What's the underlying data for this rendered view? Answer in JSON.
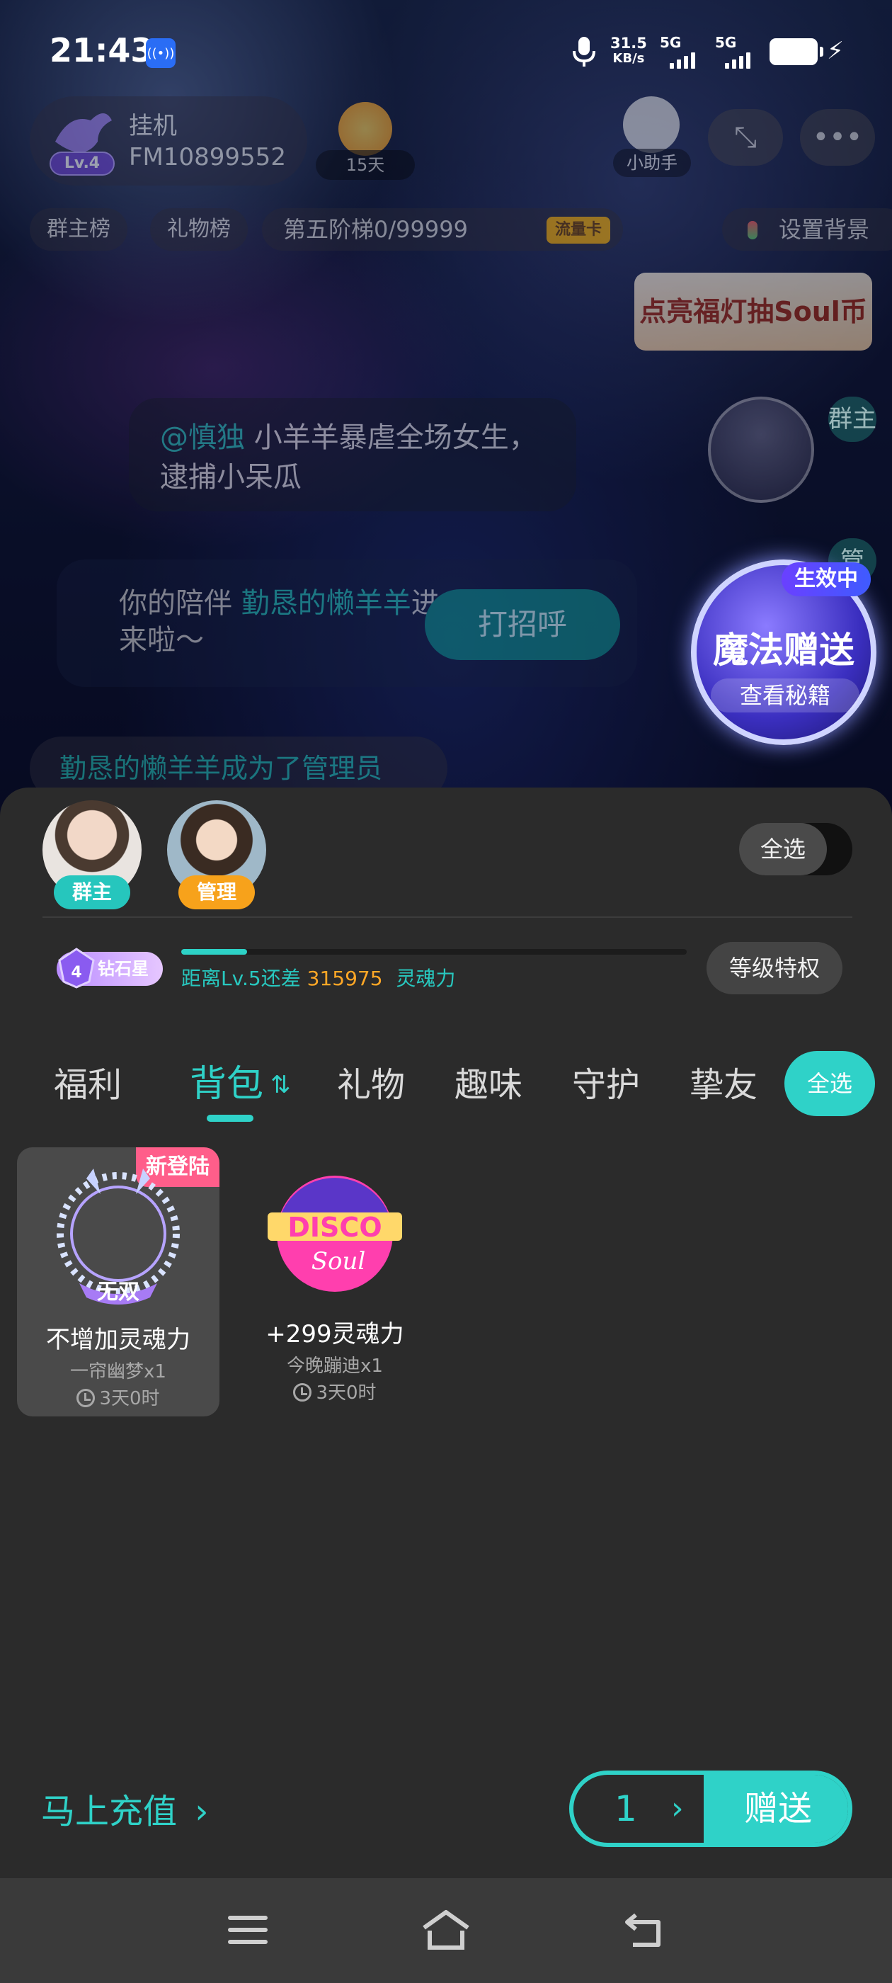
{
  "status_bar": {
    "time": "21:43",
    "net_speed_value": "31.5",
    "net_speed_unit": "KB/s",
    "sim1_label": "5G",
    "sim2_label": "5G"
  },
  "room": {
    "name": "挂机",
    "id": "FM10899552",
    "level": "Lv.4",
    "days": "15天",
    "assistant_label": "小助手",
    "chips": [
      "群主榜",
      "礼物榜"
    ],
    "ladder": "第五阶梯0/99999",
    "ladder_card": "流量卡",
    "set_background": "设置背景",
    "lucky_banner": "点亮福灯抽Soul币",
    "chat_mention": "@慎独",
    "chat_text": " 小羊羊暴虐全场女生，逮捕小呆瓜",
    "welcome_prefix": "你的陪伴 ",
    "welcome_name": "勤恳的懒羊羊",
    "welcome_suffix": "进来啦～",
    "hello_button": "打招呼",
    "admin_message": "勤恳的懒羊羊成为了管理员",
    "side_tab_1": "群主",
    "side_tab_2": "管"
  },
  "magic": {
    "active": "生效中",
    "title": "魔法赠送",
    "sub": "查看秘籍"
  },
  "panel": {
    "recipients": [
      {
        "role": "群主"
      },
      {
        "role": "管理"
      }
    ],
    "select_all_toggle": "全选",
    "level_badge": "钻石星",
    "level_badge_num": "4",
    "level_progress_fraction": 0.13,
    "level_text_prefix": "距离Lv.5还差",
    "level_text_num": "315975",
    "level_text_suffix": "灵魂力",
    "privilege_button": "等级特权",
    "tabs": [
      "福利",
      "背包",
      "礼物",
      "趣味",
      "守护",
      "挚友"
    ],
    "active_tab": "背包",
    "select_all_tab": "全选",
    "items": [
      {
        "tag": "新登陆",
        "img_text": "无双",
        "name": "不增加灵魂力",
        "sub": "一帘幽梦x1",
        "expire": "3天0时"
      },
      {
        "img_text": "DISCO",
        "img_text2": "Soul",
        "name": "+299灵魂力",
        "sub": "今晚蹦迪x1",
        "expire": "3天0时"
      }
    ],
    "recharge": "马上充值",
    "quantity": "1",
    "send_button": "赠送"
  },
  "icons": {
    "hotspot": "hotspot-icon",
    "mic": "mic-icon",
    "battery": "battery-icon",
    "charging": "bolt-icon",
    "menu": "menu-icon",
    "home": "home-icon",
    "back": "back-icon"
  },
  "colors": {
    "accent": "#2fd2c8",
    "panel_bg": "#2b2b2b",
    "host_tag": "#26c6bd",
    "admin_tag": "#f7a21b",
    "new_tag": "#ff5e8a",
    "level_num": "#ffa726"
  }
}
